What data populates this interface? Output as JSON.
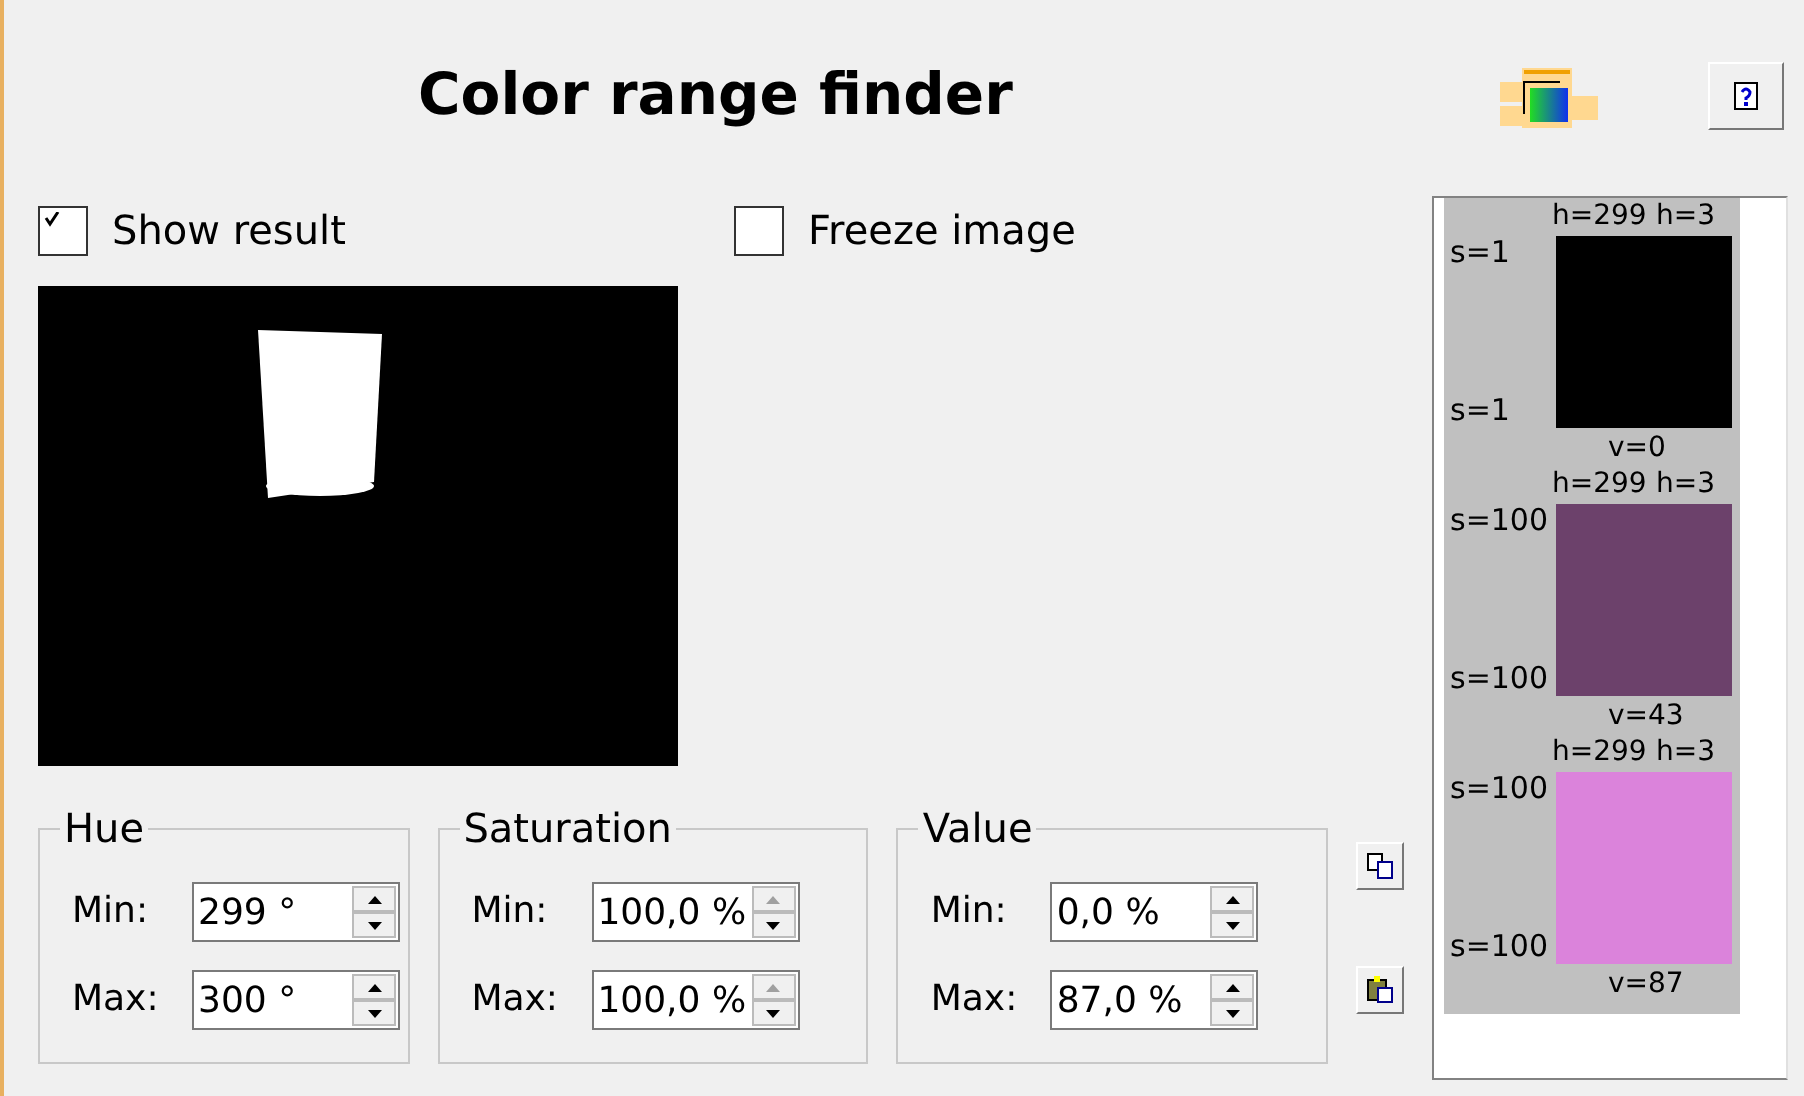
{
  "title": "Color range finder",
  "checkboxes": [
    {
      "label": "Show result",
      "checked": true
    },
    {
      "label": "Freeze image",
      "checked": false
    }
  ],
  "groups": [
    {
      "title": "Hue",
      "fields": [
        {
          "label": "Min:",
          "value": "299 °",
          "up_disabled": false
        },
        {
          "label": "Max:",
          "value": "300 °",
          "up_disabled": false
        }
      ]
    },
    {
      "title": "Saturation",
      "fields": [
        {
          "label": "Min:",
          "value": "100,0 %",
          "up_disabled": true
        },
        {
          "label": "Max:",
          "value": "100,0 %",
          "up_disabled": true
        }
      ]
    },
    {
      "title": "Value",
      "fields": [
        {
          "label": "Min:",
          "value": "0,0 %",
          "up_disabled": false
        },
        {
          "label": "Max:",
          "value": "87,0 %",
          "up_disabled": false
        }
      ]
    }
  ],
  "swatches": [
    {
      "color": "#000000",
      "h_min": "h=299",
      "h_max": "h=3",
      "s_top": "s=1",
      "s_bottom": "s=1",
      "v": "v=0"
    },
    {
      "color": "#6c416b",
      "h_min": "h=299",
      "h_max": "h=3",
      "s_top": "s=100",
      "s_bottom": "s=100",
      "v": "v=43"
    },
    {
      "color": "#db83db",
      "h_min": "h=299",
      "h_max": "h=3",
      "s_top": "s=100",
      "s_bottom": "s=100",
      "v": "v=87"
    }
  ]
}
